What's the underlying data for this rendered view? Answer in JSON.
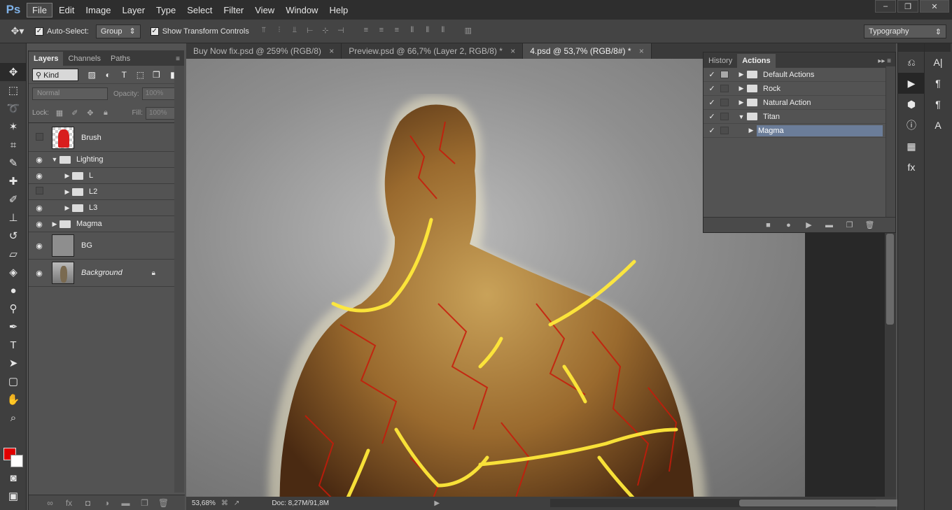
{
  "app": {
    "logo": "Ps"
  },
  "menu": [
    "File",
    "Edit",
    "Image",
    "Layer",
    "Type",
    "Select",
    "Filter",
    "View",
    "Window",
    "Help"
  ],
  "window_controls": [
    "–",
    "❐",
    "✕"
  ],
  "options": {
    "tool_icon": "move-tool-icon",
    "auto_select_label": "Auto-Select:",
    "auto_select_value": "Group",
    "transform_label": "Show Transform Controls",
    "workspace": "Typography"
  },
  "layers_panel": {
    "tabs": [
      "Layers",
      "Channels",
      "Paths"
    ],
    "kind": "Kind",
    "blend_mode": "Normal",
    "opacity_label": "Opacity:",
    "opacity_value": "100%",
    "lock_label": "Lock:",
    "fill_label": "Fill:",
    "fill_value": "100%",
    "layers": [
      {
        "name": "Brush",
        "visible": false,
        "type": "image-brush"
      },
      {
        "name": "Lighting",
        "visible": true,
        "type": "group-open"
      },
      {
        "name": "L",
        "visible": true,
        "type": "group-nested"
      },
      {
        "name": "L2",
        "visible": false,
        "type": "group-nested"
      },
      {
        "name": "L3",
        "visible": true,
        "type": "group-nested"
      },
      {
        "name": "Magma",
        "visible": true,
        "type": "group"
      },
      {
        "name": "BG",
        "visible": true,
        "type": "fill"
      },
      {
        "name": "Background",
        "visible": true,
        "type": "background-locked"
      }
    ]
  },
  "documents": {
    "tabs": [
      {
        "label": "Buy Now fix.psd @ 259% (RGB/8)",
        "active": false
      },
      {
        "label": "Preview.psd @ 66,7% (Layer 2, RGB/8) *",
        "active": false
      },
      {
        "label": "4.psd @ 53,7% (RGB/8#) *",
        "active": true
      }
    ],
    "close_glyph": "×"
  },
  "status": {
    "zoom": "53,68%",
    "doc": "Doc: 8,27M/91,8M"
  },
  "actions_panel": {
    "tabs": [
      "History",
      "Actions"
    ],
    "items": [
      {
        "name": "Default Actions",
        "dialog_on": true,
        "expanded": false,
        "type": "set"
      },
      {
        "name": "Rock",
        "dialog_on": false,
        "expanded": false,
        "type": "set"
      },
      {
        "name": "Natural Action",
        "dialog_on": false,
        "expanded": false,
        "type": "set"
      },
      {
        "name": "Titan",
        "dialog_on": false,
        "expanded": true,
        "type": "set"
      },
      {
        "name": "Magma",
        "dialog_on": false,
        "expanded": false,
        "type": "action",
        "selected": true
      }
    ]
  },
  "colors": {
    "foreground": "#e00000",
    "background": "#ffffff",
    "selection": "#6b7d99"
  }
}
